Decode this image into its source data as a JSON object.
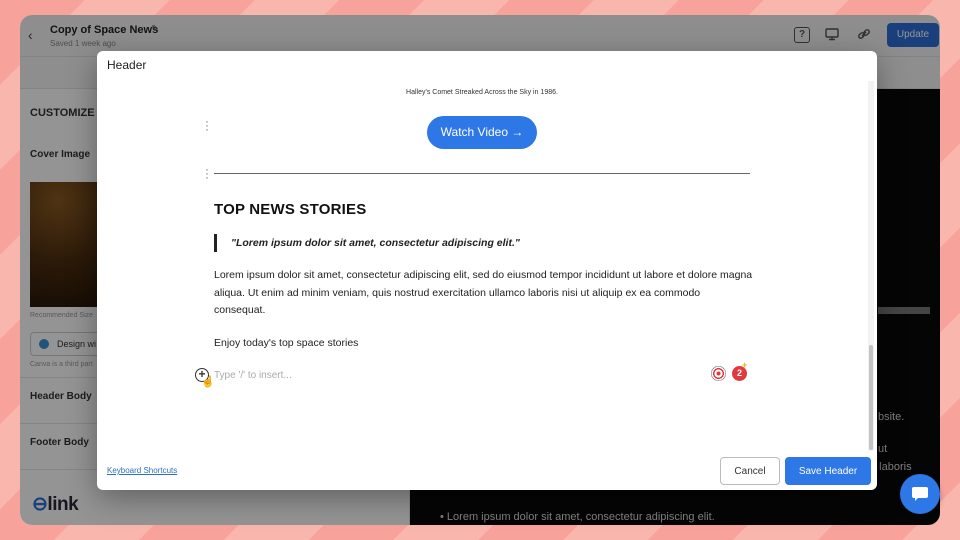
{
  "topbar": {
    "back_glyph": "‹",
    "title": "Copy of Space News",
    "saved": "Saved 1 week ago",
    "update_label": "Update",
    "icons": [
      "help-icon",
      "monitor-icon",
      "link-icon"
    ]
  },
  "left_panel": {
    "heading": "CUSTOMIZE H",
    "cover_image_label": "Cover Image",
    "recommended": "Recommended Size",
    "design_button": "Design wi",
    "canva_note": "Canva is a third part",
    "header_body": "Header Body",
    "footer_body": "Footer Body",
    "logo_prefix": "",
    "logo_text": "link"
  },
  "preview": {
    "line1": "bsite.",
    "line2": "ut",
    "line3": "o laboris",
    "bullet": "Lorem ipsum dolor sit amet, consectetur adipiscing elit."
  },
  "modal": {
    "title": "Header",
    "caption": "Halley's Comet Streaked Across the Sky in 1986.",
    "watch_video": "Watch Video →",
    "news_heading": "TOP NEWS STORIES",
    "quote": "\"Lorem ipsum dolor sit amet, consectetur adipiscing elit.\"",
    "body": "Lorem ipsum dolor sit amet, consectetur adipiscing elit, sed do eiusmod tempor incididunt ut labore et dolore magna aliqua. Ut enim ad minim veniam, quis nostrud exercitation ullamco laboris nisi ut aliquip ex ea commodo consequat.",
    "enjoy": "Enjoy today's top space stories",
    "insert_placeholder": "Type '/' to insert...",
    "badge_count": "2",
    "keyboard_shortcuts": "Keyboard Shortcuts",
    "cancel_label": "Cancel",
    "save_label": "Save Header"
  },
  "colors": {
    "accent": "#2e77e6",
    "background_stripe": "#f7a39c",
    "preview_bg": "#0a0a0a"
  }
}
